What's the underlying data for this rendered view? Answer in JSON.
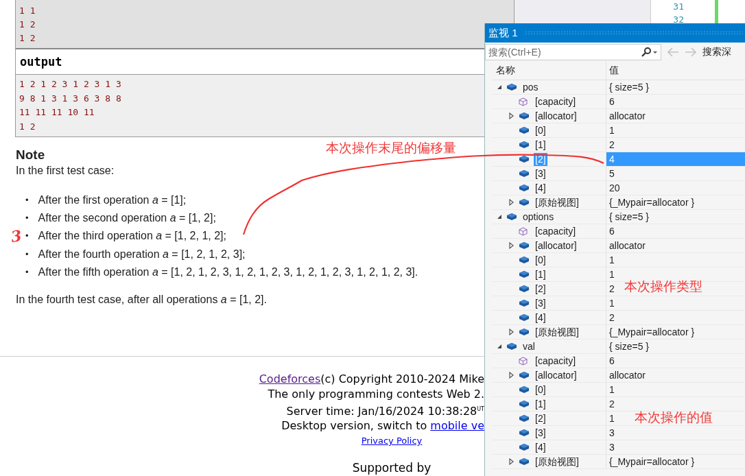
{
  "problem": {
    "input_lines": [
      "1 1",
      "1 2",
      "1 2"
    ],
    "output_title": "output",
    "output_lines": [
      "1 2 1 2 3 1 2 3 1 3",
      "9 8 1 3 1 3 6 3 8 8",
      "11 11 11 10 11",
      "1 2"
    ],
    "note_title": "Note",
    "note_intro": "In the first test case:",
    "note_items": [
      {
        "marker": "•",
        "text": "After the first operation *a* = [1];"
      },
      {
        "marker": "•",
        "text": "After the second operation *a* = [1, 2];"
      },
      {
        "marker": "•",
        "text": "After the third operation *a* = [1, 2, 1, 2];"
      },
      {
        "marker": "•",
        "text": "After the fourth operation *a* = [1, 2, 1, 2, 3];"
      },
      {
        "marker": "•",
        "text": "After the fifth operation *a* = [1, 2, 1, 2, 3, 1, 2, 1, 2, 3, 1, 2, 1, 2, 3, 1, 2, 1, 2, 3]."
      }
    ],
    "note_outro": "In the fourth test case, after all operations *a* = [1, 2]."
  },
  "footer": {
    "site_link": "Codeforces",
    "copyright": "(c) Copyright 2010-2024 Mike",
    "tagline": "The only programming contests Web 2.",
    "server_time": "Server time: Jan/16/2024 10:38:28$^{UT}$",
    "desktop_text": "Desktop version, switch to",
    "mobile_link": "mobile ve",
    "privacy_link": "Privacy Policy",
    "supported": "Supported by"
  },
  "editor": {
    "line_numbers": [
      "31",
      "32"
    ]
  },
  "watch": {
    "title": "监视 1",
    "search": {
      "placeholder": "搜索(Ctrl+E)"
    },
    "back_disabled": true,
    "forward_disabled": true,
    "depth_label": "搜索深",
    "columns": [
      "名称",
      "值"
    ],
    "items": [
      {
        "name": "pos",
        "value": "{ size=5 }",
        "kind": "field",
        "expanded": true,
        "selected": false,
        "children": [
          {
            "name": "[capacity]",
            "value": "6",
            "kind": "property",
            "selected": false
          },
          {
            "name": "[allocator]",
            "value": "allocator",
            "kind": "field",
            "expanded": false,
            "selected": false
          },
          {
            "name": "[0]",
            "value": "1",
            "kind": "field",
            "selected": false
          },
          {
            "name": "[1]",
            "value": "2",
            "kind": "field",
            "selected": false
          },
          {
            "name": "[2]",
            "value": "4",
            "kind": "field",
            "selected": true
          },
          {
            "name": "[3]",
            "value": "5",
            "kind": "field",
            "selected": false
          },
          {
            "name": "[4]",
            "value": "20",
            "kind": "field",
            "selected": false
          },
          {
            "name": "[原始视图]",
            "value": "{_Mypair=allocator }",
            "kind": "field",
            "expanded": false,
            "selected": false
          }
        ]
      },
      {
        "name": "options",
        "value": "{ size=5 }",
        "kind": "field",
        "expanded": true,
        "selected": false,
        "children": [
          {
            "name": "[capacity]",
            "value": "6",
            "kind": "property",
            "selected": false
          },
          {
            "name": "[allocator]",
            "value": "allocator",
            "kind": "field",
            "expanded": false,
            "selected": false
          },
          {
            "name": "[0]",
            "value": "1",
            "kind": "field",
            "selected": false
          },
          {
            "name": "[1]",
            "value": "1",
            "kind": "field",
            "selected": false
          },
          {
            "name": "[2]",
            "value": "2",
            "kind": "field",
            "selected": false
          },
          {
            "name": "[3]",
            "value": "1",
            "kind": "field",
            "selected": false
          },
          {
            "name": "[4]",
            "value": "2",
            "kind": "field",
            "selected": false
          },
          {
            "name": "[原始视图]",
            "value": "{_Mypair=allocator }",
            "kind": "field",
            "expanded": false,
            "selected": false
          }
        ]
      },
      {
        "name": "val",
        "value": "{ size=5 }",
        "kind": "field",
        "expanded": true,
        "selected": false,
        "children": [
          {
            "name": "[capacity]",
            "value": "6",
            "kind": "property",
            "selected": false
          },
          {
            "name": "[allocator]",
            "value": "allocator",
            "kind": "field",
            "expanded": false,
            "selected": false
          },
          {
            "name": "[0]",
            "value": "1",
            "kind": "field",
            "selected": false
          },
          {
            "name": "[1]",
            "value": "2",
            "kind": "field",
            "selected": false
          },
          {
            "name": "[2]",
            "value": "1",
            "kind": "field",
            "selected": false
          },
          {
            "name": "[3]",
            "value": "3",
            "kind": "field",
            "selected": false
          },
          {
            "name": "[4]",
            "value": "3",
            "kind": "field",
            "selected": false
          },
          {
            "name": "[原始视图]",
            "value": "{_Mypair=allocator }",
            "kind": "field",
            "expanded": false,
            "selected": false
          }
        ]
      }
    ]
  },
  "annotations": [
    {
      "kind": "label",
      "text": "本次操作末尾的偏移量"
    },
    {
      "kind": "digit",
      "text": "3"
    },
    {
      "kind": "label",
      "text": "本次操作类型"
    },
    {
      "kind": "label",
      "text": "本次操作的值"
    }
  ]
}
